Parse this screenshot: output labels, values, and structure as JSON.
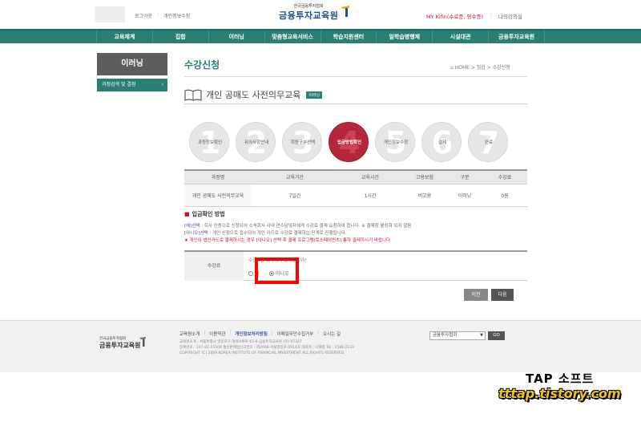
{
  "header": {
    "links": [
      "로그아웃",
      "개인정보수정"
    ],
    "brand_small": "한국금융투자협회",
    "brand_name": "금융투자교육원",
    "user": "MY Kifin(수료증, 영수증)",
    "myroom": "나의강의실"
  },
  "gnb": [
    "교육체계",
    "집합",
    "이러닝",
    "맞춤형교육서비스",
    "학습지원센터",
    "일학습병행제",
    "시설대관",
    "금융투자교육원"
  ],
  "sidebar": {
    "title": "이러닝",
    "item": "과정검색 및 결정"
  },
  "page": {
    "title": "수강신청",
    "breadcrumb": "HOME > 집합 > 수강신청"
  },
  "course": {
    "name": "개인 공매도 사전의무교육",
    "tag": "이러닝"
  },
  "steps": [
    {
      "num": "1",
      "label": "과정정보확인",
      "active": false
    },
    {
      "num": "2",
      "label": "유의사항안내",
      "active": false
    },
    {
      "num": "3",
      "label": "회원구분선택",
      "active": false
    },
    {
      "num": "4",
      "label": "입금방법확인",
      "active": true
    },
    {
      "num": "5",
      "label": "개인정보수정",
      "active": false
    },
    {
      "num": "6",
      "label": "결제",
      "active": false
    },
    {
      "num": "7",
      "label": "완료",
      "active": false
    }
  ],
  "table": {
    "headers": [
      "과정명",
      "교육기간",
      "교육시간",
      "고용보험",
      "구분",
      "수강료"
    ],
    "row": [
      "개인 공매도 사전의무교육",
      "7일간",
      "1시간",
      "비고용",
      "이러닝",
      "0원"
    ]
  },
  "payment": {
    "heading": "입금확인 방법",
    "note_yes_label": "[예]선택",
    "note_yes_text": " : 회사 인증으로 신청되어 소속회사 사내 연수담당자에게 수강료 결제 요청하여 합니다. ※ 결제창 활성화 되지 않음",
    "note_no_label": "[아니오]선택",
    "note_no_text": " : 개인 신청으로 접수되어 개인 카드로 수강료 결제하는 단계로 진행됩니다.",
    "note_warn": "★ 개인이 법인카드로 결제하시는 경우 [아니오] 선택 후 결제 프로그램(토스페이먼츠) 통하 결제하시기 바랍니다.",
    "field_label": "수강료",
    "question": "수강료를 회사에서 결제합니까?",
    "opt_yes": "예",
    "opt_no": "아니오",
    "selected": "아니오"
  },
  "buttons": {
    "prev": "이전",
    "next": "다음"
  },
  "footer": {
    "logo_small": "한국금융투자협회",
    "logo_name": "금융투자교육원",
    "links": [
      "교육원소개",
      "이용약관",
      "개인정보처리방침",
      "이메일무단수집거부",
      "오시는 길"
    ],
    "address1": "교육원소개 : 서울특별시 영등포구 여의나루로 67-8 금융투자교육원 (우) 07327",
    "address2": "등록번호 : 107-82-15509 통신판매업신고번호 : 제2008-서울영등포-0914호 대표자 : 나재철 Tel : 1588-2133",
    "copyright": "COPYRIGHT (C) 2009 KOREA INSTITUTE OF FINANCIAL INVESTMENT ALL RIGHTS RESERVED.",
    "select_value": "금융투자협회",
    "go": "GO"
  },
  "watermark": {
    "line1": "TAP 소프트",
    "line2": "tttap.tistory.com"
  },
  "colors": {
    "accent": "#2a7e74",
    "active_step": "#b5263a",
    "highlight": "#ff0000"
  }
}
